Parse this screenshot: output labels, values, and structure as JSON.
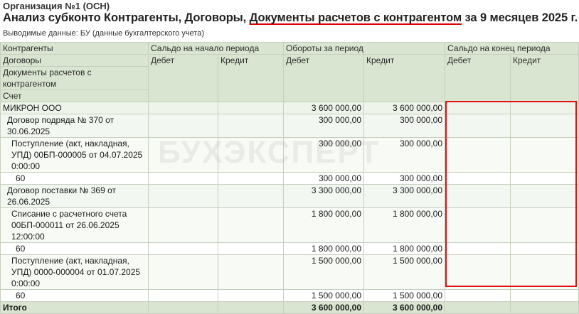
{
  "header": {
    "organization": "Организация №1 (ОСН)",
    "title_part1": "Анализ субконто Контрагенты, Договоры, ",
    "title_highlight": "Документы расчетов с контрагентом",
    "title_part2": " за 9 месяцев 2025 г.",
    "subtitle": "Выводимые данные: БУ (данные бухгалтерского учета)"
  },
  "watermark": "БУХЭКСПЕРТ",
  "columns": {
    "contractors": "Контрагенты",
    "contracts": "Договоры",
    "documents": "Документы расчетов с контрагентом",
    "account": "Счет",
    "opening_balance": "Сальдо на начало периода",
    "turnover": "Обороты за период",
    "closing_balance": "Сальдо на конец периода",
    "debit": "Дебет",
    "credit": "Кредит"
  },
  "rows": [
    {
      "label": "МИКРОН ООО",
      "turnover_debit": "3 600 000,00",
      "turnover_credit": "3 600 000,00"
    },
    {
      "label": "Договор подряда № 370 от 30.06.2025",
      "turnover_debit": "300 000,00",
      "turnover_credit": "300 000,00"
    },
    {
      "label": "Поступление (акт, накладная, УПД) 00БП-000005 от 04.07.2025 0:00:00",
      "turnover_debit": "300 000,00",
      "turnover_credit": "300 000,00"
    },
    {
      "label": "60",
      "turnover_debit": "300 000,00",
      "turnover_credit": "300 000,00"
    },
    {
      "label": "Договор поставки № 369 от 26.06.2025",
      "turnover_debit": "3 300 000,00",
      "turnover_credit": "3 300 000,00"
    },
    {
      "label": "Списание с расчетного счета 00БП-000011 от 26.06.2025 12:00:00",
      "turnover_debit": "1 800 000,00",
      "turnover_credit": "1 800 000,00"
    },
    {
      "label": "60",
      "turnover_debit": "1 800 000,00",
      "turnover_credit": "1 800 000,00"
    },
    {
      "label": "Поступление (акт, накладная, УПД) 0000-000004 от 01.07.2025 0:00:00",
      "turnover_debit": "1 500 000,00",
      "turnover_credit": "1 500 000,00"
    },
    {
      "label": "60",
      "turnover_debit": "1 500 000,00",
      "turnover_credit": "1 500 000,00"
    }
  ],
  "total": {
    "label": "Итого",
    "turnover_debit": "3 600 000,00",
    "turnover_credit": "3 600 000,00"
  },
  "highlight_color": "#e01010"
}
